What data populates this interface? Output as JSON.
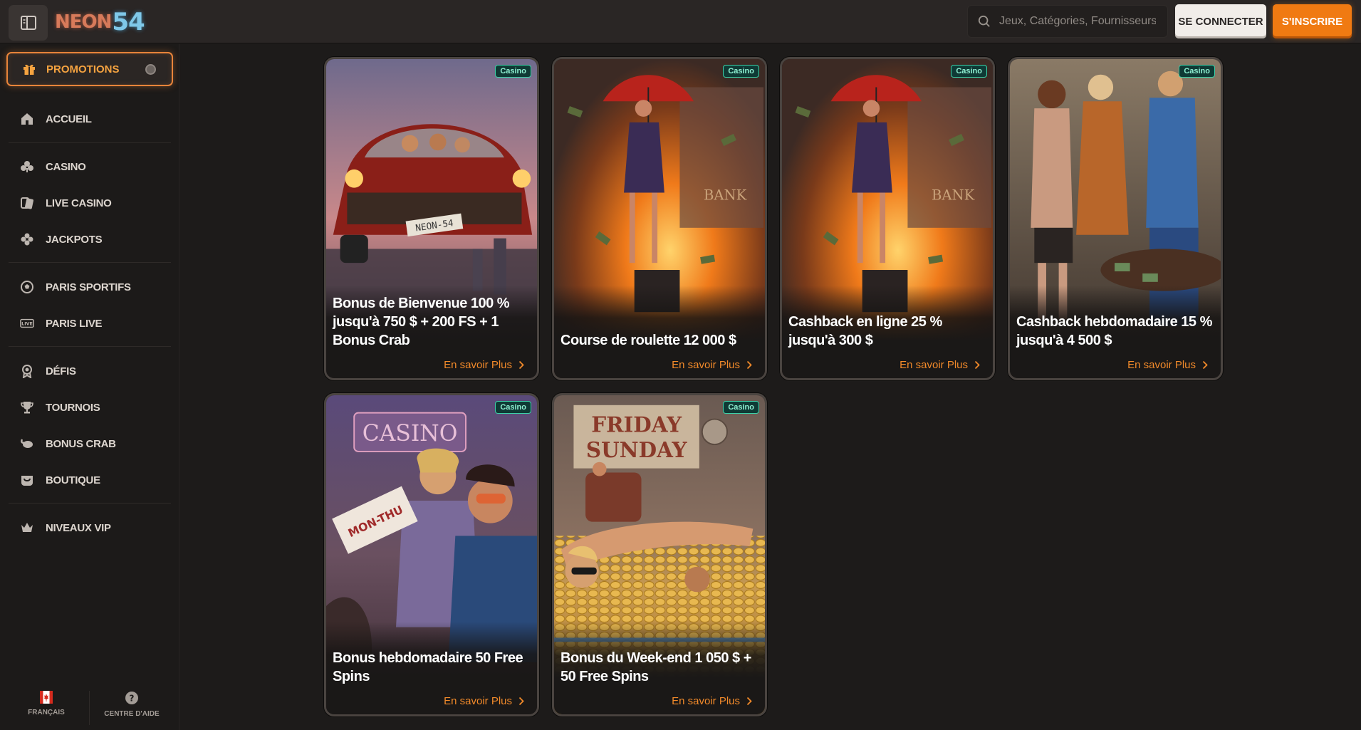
{
  "header": {
    "logo_text": "NEON",
    "logo_number": "54",
    "search_placeholder": "Jeux, Catégories, Fournisseurs",
    "login_label": "SE CONNECTER",
    "signup_label": "S'INSCRIRE"
  },
  "sidebar": {
    "promo_label": "PROMOTIONS",
    "items": [
      {
        "label": "ACCUEIL",
        "icon": "home-icon"
      },
      {
        "label": "CASINO",
        "icon": "club-icon"
      },
      {
        "label": "LIVE CASINO",
        "icon": "cards-icon"
      },
      {
        "label": "JACKPOTS",
        "icon": "clover-icon"
      },
      {
        "label": "PARIS SPORTIFS",
        "icon": "soccer-ball-icon"
      },
      {
        "label": "PARIS LIVE",
        "icon": "live-icon"
      },
      {
        "label": "DÉFIS",
        "icon": "award-icon"
      },
      {
        "label": "TOURNOIS",
        "icon": "trophy-icon"
      },
      {
        "label": "BONUS CRAB",
        "icon": "crab-icon"
      },
      {
        "label": "BOUTIQUE",
        "icon": "shop-icon"
      },
      {
        "label": "NIVEAUX VIP",
        "icon": "crown-icon"
      }
    ],
    "footer": {
      "language_label": "FRANÇAIS",
      "help_label": "CENTRE D'AIDE"
    }
  },
  "promotions": [
    {
      "badge": "Casino",
      "title": "Bonus de Bienvenue 100 % jusqu'à 750 $ + 200 FS + 1 Bonus Crab",
      "link": "En savoir Plus"
    },
    {
      "badge": "Casino",
      "title": "Course de roulette 12 000 $",
      "link": "En savoir Plus"
    },
    {
      "badge": "Casino",
      "title": "Cashback en ligne 25 % jusqu'à 300 $",
      "link": "En savoir Plus"
    },
    {
      "badge": "Casino",
      "title": "Cashback hebdomadaire 15 % jusqu'à 4 500 $",
      "link": "En savoir Plus"
    },
    {
      "badge": "Casino",
      "title": "Bonus hebdomadaire 50 Free Spins",
      "link": "En savoir Plus"
    },
    {
      "badge": "Casino",
      "title": "Bonus du Week-end 1 050 $ + 50 Free Spins",
      "link": "En savoir Plus"
    }
  ],
  "art_text": {
    "plate": "NEON-54",
    "bank": "BANK",
    "casino_sign": "CASINO",
    "ticket": "MON-THU",
    "friday": "FRIDAY",
    "sunday": "SUNDAY"
  },
  "colors": {
    "accent_orange": "#f07a12",
    "badge_green": "#3bd1a8",
    "background": "#1d1b1a"
  }
}
